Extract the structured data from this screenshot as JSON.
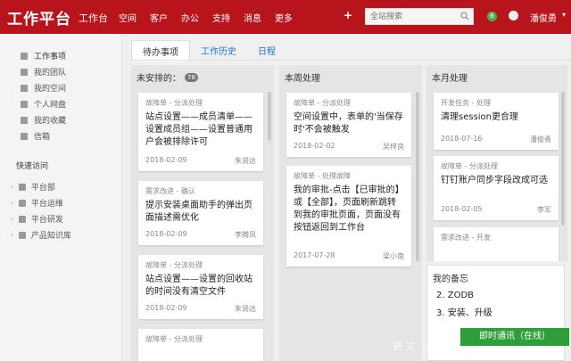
{
  "header": {
    "brand": "工作平台",
    "nav": [
      "工作台",
      "空间",
      "客户",
      "办公",
      "支持",
      "消息",
      "更多"
    ],
    "plus": "+",
    "search_placeholder": "全站搜索",
    "notify_count": "6",
    "user": "潘俊勇",
    "accent": "#b8141b"
  },
  "sidebar": {
    "items": [
      {
        "label": "工作事项",
        "icon": "check-icon"
      },
      {
        "label": "我的团队",
        "icon": "team-icon"
      },
      {
        "label": "我的空间",
        "icon": "cube-icon"
      },
      {
        "label": "个人网盘",
        "icon": "folder-icon"
      },
      {
        "label": "我的收藏",
        "icon": "star-icon"
      },
      {
        "label": "信箱",
        "icon": "mail-icon"
      }
    ],
    "quick_title": "快速访问",
    "quick": [
      "平台部",
      "平台运维",
      "平台研发",
      "产品知识库"
    ]
  },
  "tabs": [
    "待办事项",
    "工作历史",
    "日程"
  ],
  "columns": {
    "unscheduled": {
      "title": "未安排的：",
      "count": "78",
      "cards": [
        {
          "cat": "故障单 - 分派处理",
          "title": "站点设置——成员清单——设置成员组——设置普通用户会被排除许可",
          "date": "2018-02-09",
          "user": "朱贤达"
        },
        {
          "cat": "需求改进 - 确认",
          "title": "提示安装桌面助手的弹出页面描述需优化",
          "date": "2018-02-09",
          "user": "李腾凤"
        },
        {
          "cat": "故障单 - 分派处理",
          "title": "站点设置——设置的回收站的时间没有清空文件",
          "date": "2018-02-09",
          "user": "朱贤达"
        },
        {
          "cat": "故障单 - 分派处理",
          "title": "",
          "date": "",
          "user": ""
        }
      ]
    },
    "week": {
      "title": "本周处理",
      "cards": [
        {
          "cat": "故障单 - 分派处理",
          "title": "空间设置中，表单的'当保存时'不会被触发",
          "date": "2018-02-02",
          "user": "吴梓良"
        },
        {
          "cat": "故障单 - 处理故障",
          "title": "我的审批-点击【已审批的】或【全部】，页面刷新跳转到我的审批页面，页面没有按钮返回到工作台",
          "date": "2017-07-28",
          "user": "梁小南"
        }
      ]
    },
    "month": {
      "title": "本月处理",
      "cards": [
        {
          "cat": "开发任务 - 处理",
          "title": "清理session更合理",
          "date": "2018-07-16",
          "user": "潘俊勇"
        },
        {
          "cat": "故障单 - 分派处理",
          "title": "钉钉账户同步字段改成可选",
          "date": "2018-02-05",
          "user": "李军"
        },
        {
          "cat": "需求改进 - 开发",
          "title": "",
          "date": "",
          "user": ""
        }
      ]
    }
  },
  "memo": {
    "title": "我的备忘",
    "lines": [
      "2. ZODB",
      "3. 安装、升级"
    ]
  },
  "chat_button": "即时通讯（在线）",
  "watermark": "普 文 ..."
}
